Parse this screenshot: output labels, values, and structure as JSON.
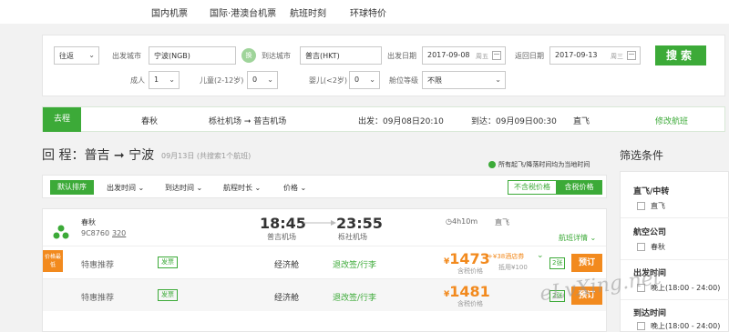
{
  "topnav": {
    "items": [
      "国内机票",
      "国际·港澳台机票",
      "航班时刻",
      "环球特价"
    ]
  },
  "search": {
    "trip_type": "往返",
    "from_label": "出发城市",
    "from_value": "宁波(NGB)",
    "swap_label": "换",
    "to_label": "到达城市",
    "to_value": "普吉(HKT)",
    "depart_label": "出发日期",
    "depart_value": "2017-09-08",
    "depart_weekday": "周五",
    "return_label": "返回日期",
    "return_value": "2017-09-13",
    "return_weekday": "周三",
    "search_button": "搜索",
    "adult_label": "成人",
    "adult_value": "1",
    "child_label": "儿童(2-12岁)",
    "child_value": "0",
    "infant_label": "婴儿(<2岁)",
    "infant_value": "0",
    "cabin_label": "舱位等级",
    "cabin_value": "不限"
  },
  "outbound": {
    "tag": "去程",
    "airline": "春秋",
    "route_from": "栎社机场",
    "route_to": "普吉机场",
    "depart": "出发：09月08日20:10",
    "arrive": "到达：09月09日00:30",
    "type": "直飞",
    "modify_link": "修改航班"
  },
  "return_header": {
    "title": "回 程：普吉 ➞ 宁波",
    "subtitle": "09月13日 (共搜索1个航班)",
    "notice": "所有起飞/降落时间均为当地时间"
  },
  "sortbar": {
    "default": "默认排序",
    "items": [
      "出发时间",
      "到达时间",
      "航程时长",
      "价格"
    ],
    "price_excl": "不含税价格",
    "price_incl": "含税价格"
  },
  "flight": {
    "airline": "春秋",
    "flight_no": "9C8760",
    "aircraft": "320",
    "depart_time": "18:45",
    "depart_airport": "普吉机场",
    "arrive_time": "23:55",
    "arrive_airport": "栎社机场",
    "duration": "4h10m",
    "type": "直飞",
    "details_link": "航班详情",
    "fares": [
      {
        "promo_tag": "价格最低",
        "label": "特惠推荐",
        "fapiao": "发票",
        "cabin": "经济舱",
        "rules": "退改签/行李",
        "currency": "¥",
        "price": "1473",
        "tax_label": "含税价格",
        "coupon": "+¥38酒店券",
        "coupon_sub": "抵用¥100",
        "remaining": "2张",
        "book": "预订"
      },
      {
        "label": "特惠推荐",
        "fapiao": "发票",
        "cabin": "经济舱",
        "rules": "退改签/行李",
        "currency": "¥",
        "price": "1481",
        "tax_label": "含税价格",
        "remaining": "2张",
        "book": "预订"
      }
    ]
  },
  "sidebar": {
    "title": "筛选条件",
    "sections": [
      {
        "heading": "直飞/中转",
        "options": [
          "直飞"
        ]
      },
      {
        "heading": "航空公司",
        "options": [
          "春秋"
        ]
      },
      {
        "heading": "出发时间",
        "options": [
          "晚上(18:00 - 24:00)"
        ]
      },
      {
        "heading": "到达时间",
        "options": [
          "晚上(18:00 - 24:00)"
        ]
      }
    ]
  },
  "watermark": "eLvXing.net",
  "colors": {
    "accent": "#3caa38",
    "orange": "#f28a1e"
  }
}
